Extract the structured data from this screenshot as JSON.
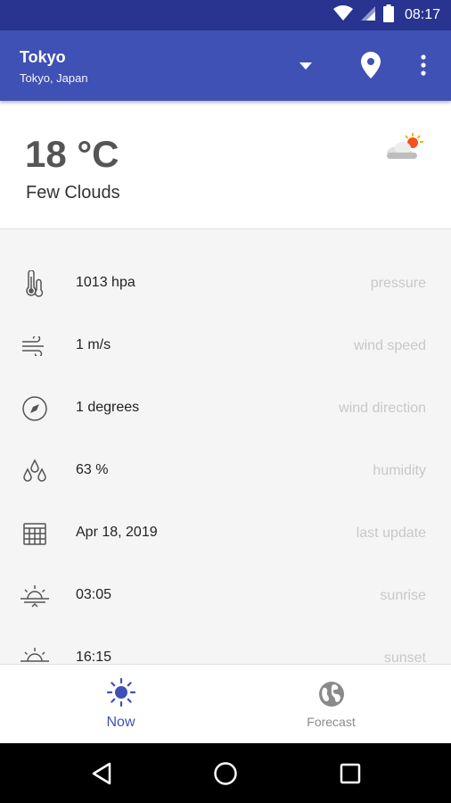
{
  "status_bar": {
    "time": "08:17"
  },
  "app_bar": {
    "city": "Tokyo",
    "location": "Tokyo, Japan"
  },
  "current": {
    "temperature": "18 °C",
    "condition": "Few Clouds"
  },
  "details": [
    {
      "icon": "thermometer-icon",
      "value": "1013 hpa",
      "label": "pressure"
    },
    {
      "icon": "wind-icon",
      "value": "1 m/s",
      "label": "wind speed"
    },
    {
      "icon": "compass-icon",
      "value": "1 degrees",
      "label": "wind direction"
    },
    {
      "icon": "humidity-icon",
      "value": "63 %",
      "label": "humidity"
    },
    {
      "icon": "calendar-icon",
      "value": "Apr 18, 2019",
      "label": "last update"
    },
    {
      "icon": "sunrise-icon",
      "value": "03:05",
      "label": "sunrise"
    },
    {
      "icon": "sunset-icon",
      "value": "16:15",
      "label": "sunset"
    }
  ],
  "bottom_nav": {
    "now_label": "Now",
    "forecast_label": "Forecast"
  },
  "colors": {
    "primary": "#3f51b5",
    "primary_dark": "#28348f",
    "sun": "#ffb300"
  }
}
